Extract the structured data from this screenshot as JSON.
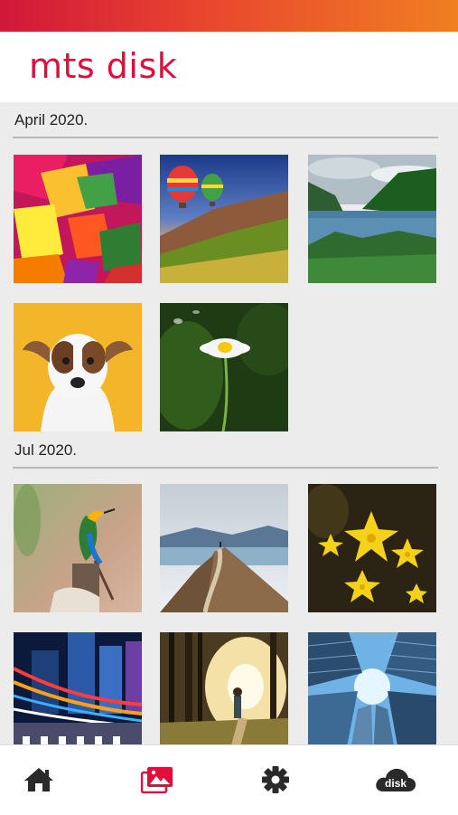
{
  "app": {
    "logo": "mts disk"
  },
  "colors": {
    "brand": "#e30d3b",
    "status_bar_start": "#d1173a",
    "status_bar_end": "#f07f22",
    "nav_inactive": "#2a2a2a"
  },
  "gallery": {
    "sections": [
      {
        "title": "April 2020.",
        "photos": [
          "autumn-leaves",
          "hot-air-balloons",
          "mountain-lake",
          "dog-portrait",
          "daisy-flower"
        ]
      },
      {
        "title": "Jul 2020.",
        "photos": [
          "bird-on-stump",
          "mountain-ridge-path",
          "yellow-flowers",
          "city-light-trails",
          "forest-walk",
          "skyscrapers-looking-up"
        ]
      }
    ]
  },
  "bottom_nav": {
    "items": [
      {
        "name": "home",
        "icon": "home-icon",
        "active": false
      },
      {
        "name": "gallery",
        "icon": "gallery-icon",
        "active": true
      },
      {
        "name": "settings",
        "icon": "gear-icon",
        "active": false
      },
      {
        "name": "disk",
        "icon": "cloud-disk-icon",
        "label": "disk",
        "active": false
      }
    ]
  }
}
